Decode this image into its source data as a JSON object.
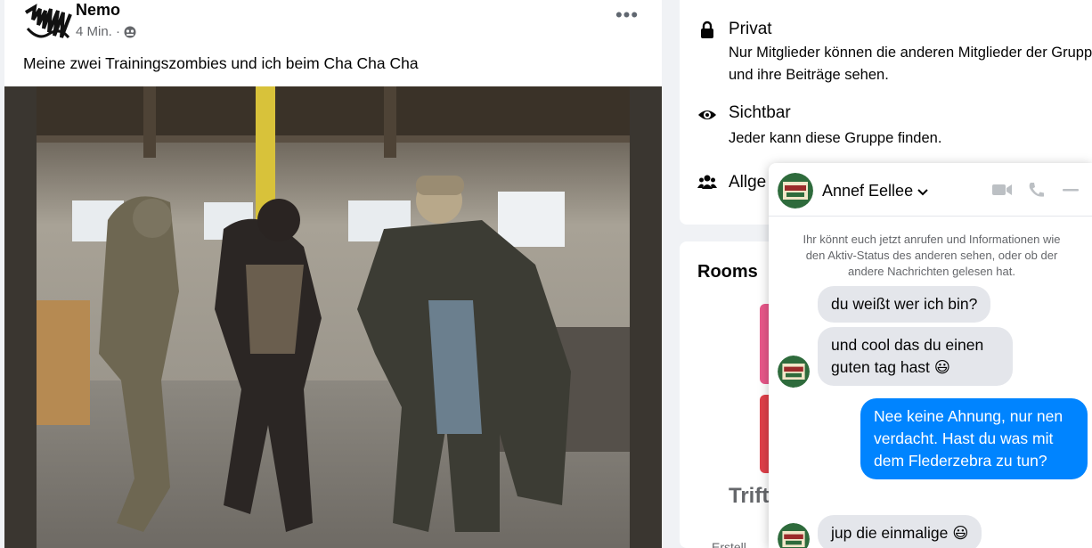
{
  "post": {
    "author": "Nemo",
    "time": "4 Min. ·",
    "audience_icon": "group-audience-icon",
    "text": "Meine zwei Trainingszombies und ich beim Cha Cha Cha",
    "more_icon": "more-options-icon"
  },
  "group_info": {
    "private": {
      "icon": "lock-icon",
      "title": "Privat",
      "desc": "Nur Mitglieder können die anderen Mitglieder der Gruppe und ihre Beiträge sehen."
    },
    "visible": {
      "icon": "eye-icon",
      "title": "Sichtbar",
      "desc": "Jeder kann diese Gruppe finden."
    },
    "general": {
      "icon": "people-icon",
      "title": "Allge"
    }
  },
  "rooms": {
    "title": "Rooms",
    "trift": "Trift",
    "erst": "Erstell"
  },
  "chat": {
    "name": "Annef Eellee",
    "notice": "Ihr könnt euch jetzt anrufen und Informationen wie den Aktiv-Status des anderen sehen, oder ob der andere Nachrichten gelesen hat.",
    "messages": [
      {
        "from": "them",
        "text": "du weißt wer ich bin?"
      },
      {
        "from": "them",
        "text": "und cool das du einen guten tag hast 😃"
      },
      {
        "from": "me",
        "text": "Nee keine Ahnung, nur nen verdacht. Hast du was mit dem Flederzebra zu tun?"
      },
      {
        "from": "them",
        "text": "jup die einmalige 😃"
      }
    ],
    "colors": {
      "outgoing": "#0084ff",
      "incoming": "#e4e6eb"
    }
  }
}
